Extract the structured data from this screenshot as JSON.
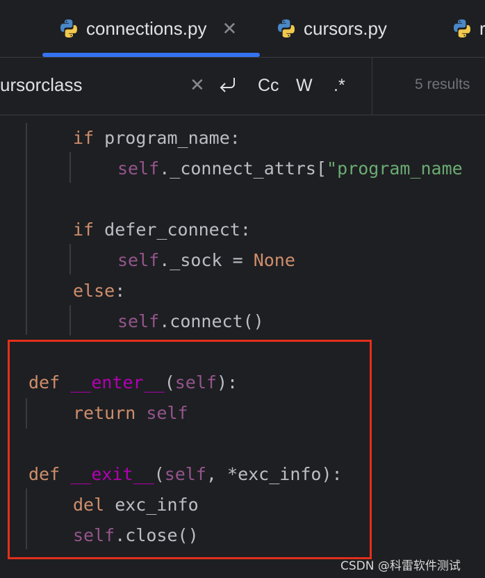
{
  "tabs": [
    {
      "label": "connections.py",
      "active": true,
      "closable": true
    },
    {
      "label": "cursors.py",
      "active": false,
      "closable": false
    },
    {
      "label": "r",
      "active": false,
      "closable": false
    }
  ],
  "search": {
    "query": "ursorclass",
    "options": [
      "Cc",
      "W",
      ".*"
    ],
    "results": "5 results"
  },
  "code": {
    "l1a": "if",
    "l1b": " program_name:",
    "l2a": "self",
    "l2b": "._connect_attrs[",
    "l2c": "\"program_name",
    "l4a": "if",
    "l4b": " defer_connect:",
    "l5a": "self",
    "l5b": "._sock = ",
    "l5c": "None",
    "l6a": "else",
    "l6b": ":",
    "l7a": "self",
    "l7b": ".connect()",
    "l9a": "def",
    "l9b": "__enter__",
    "l9c": "(",
    "l9d": "self",
    "l9e": "):",
    "l10a": "return",
    "l10b": "self",
    "l12a": "def",
    "l12b": "__exit__",
    "l12c": "(",
    "l12d": "self",
    "l12e": ", *exc_info):",
    "l13a": "del",
    "l13b": " exc_info",
    "l14a": "self",
    "l14b": ".close()"
  },
  "watermark": "CSDN @科雷软件测试",
  "colors": {
    "accent": "#3574f0",
    "highlight": "#e3301c"
  }
}
